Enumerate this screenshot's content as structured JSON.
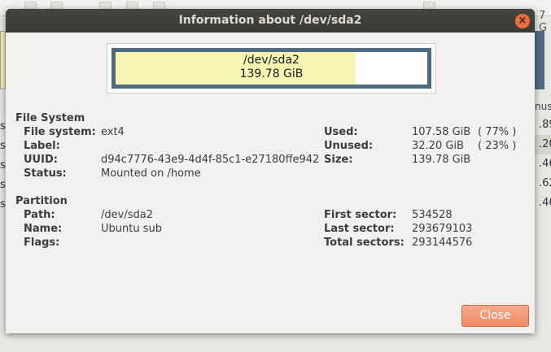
{
  "background_app": {
    "right_header": "7 G",
    "column_header": "nus",
    "rows": [
      ".89",
      ".20",
      ".46",
      ".62",
      ".46"
    ],
    "left_column_header": "",
    "left_rows": [
      "se",
      "se",
      "se",
      "se",
      "se"
    ]
  },
  "dialog": {
    "title": "Information about /dev/sda2",
    "close_x": "×",
    "usage_bar": {
      "device": "/dev/sda2",
      "size": "139.78 GiB",
      "used_fraction": 0.77,
      "used_color": "#f7f5b4",
      "frame_color": "#4e6a83"
    },
    "file_system": {
      "heading": "File System",
      "fields": [
        {
          "label": "File system:",
          "value": "ext4"
        },
        {
          "label": "Label:",
          "value": ""
        },
        {
          "label": "UUID:",
          "value": "d94c7776-43e9-4d4f-85c1-e27180ffe942"
        },
        {
          "label": "Status:",
          "value": "Mounted on /home"
        }
      ],
      "usage": [
        {
          "label": "Used:",
          "value": "107.58 GiB",
          "percent": "( 77% )"
        },
        {
          "label": "Unused:",
          "value": "32.20 GiB",
          "percent": "( 23% )"
        },
        {
          "label": "Size:",
          "value": "139.78 GiB",
          "percent": ""
        }
      ]
    },
    "partition": {
      "heading": "Partition",
      "fields": [
        {
          "label": "Path:",
          "value": "/dev/sda2"
        },
        {
          "label": "Name:",
          "value": "Ubuntu sub"
        },
        {
          "label": "Flags:",
          "value": ""
        }
      ],
      "sectors": [
        {
          "label": "First sector:",
          "value": "534528"
        },
        {
          "label": "Last sector:",
          "value": "293679103"
        },
        {
          "label": "Total sectors:",
          "value": "293144576"
        }
      ]
    },
    "close_button": "Close",
    "accent_color": "#ef8c68"
  }
}
